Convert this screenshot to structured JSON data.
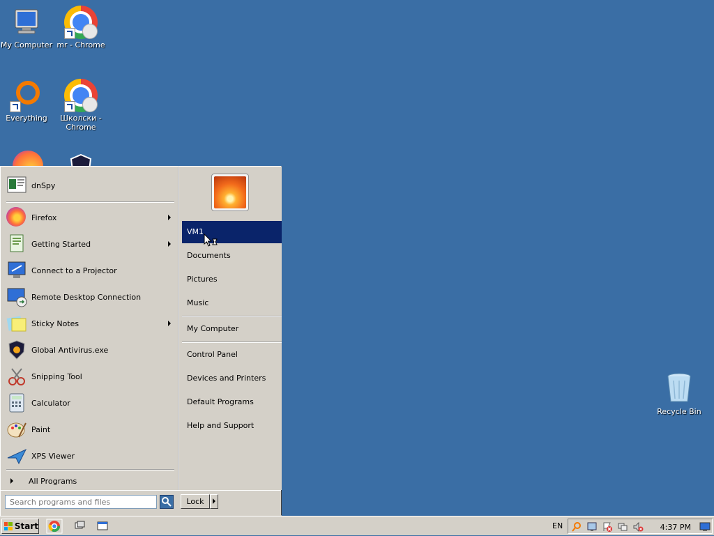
{
  "desktop": {
    "icons": [
      {
        "label": "My Computer",
        "icon": "computer-icon"
      },
      {
        "label": "mr - Chrome",
        "icon": "chrome-icon"
      },
      {
        "label": "Everything",
        "icon": "everything-icon"
      },
      {
        "label": "Школски - Chrome",
        "icon": "chrome-icon"
      }
    ],
    "recycle_bin": {
      "label": "Recycle Bin",
      "icon": "recycle-bin-icon"
    }
  },
  "start_menu": {
    "pinned": {
      "label": "dnSpy",
      "icon": "dnspy-icon"
    },
    "recent": [
      {
        "label": "Firefox",
        "icon": "firefox-icon",
        "submenu": true
      },
      {
        "label": "Getting Started",
        "icon": "getting-started-icon",
        "submenu": true
      },
      {
        "label": "Connect to a Projector",
        "icon": "projector-icon",
        "submenu": false
      },
      {
        "label": "Remote Desktop Connection",
        "icon": "remote-desktop-icon",
        "submenu": false
      },
      {
        "label": "Sticky Notes",
        "icon": "sticky-notes-icon",
        "submenu": true
      },
      {
        "label": "Global Antivirus.exe",
        "icon": "antivirus-shield-icon",
        "submenu": false
      },
      {
        "label": "Snipping Tool",
        "icon": "snipping-tool-icon",
        "submenu": false
      },
      {
        "label": "Calculator",
        "icon": "calculator-icon",
        "submenu": false
      },
      {
        "label": "Paint",
        "icon": "paint-icon",
        "submenu": false
      },
      {
        "label": "XPS Viewer",
        "icon": "xps-viewer-icon",
        "submenu": false
      }
    ],
    "all_programs": "All Programs",
    "right": {
      "user_section": [
        "VM1",
        "Documents",
        "Pictures",
        "Music"
      ],
      "computer_section": [
        "My Computer"
      ],
      "system_section": [
        "Control Panel",
        "Devices and Printers",
        "Default Programs",
        "Help and Support"
      ],
      "selected": "VM1"
    },
    "search": {
      "placeholder": "Search programs and files",
      "value": ""
    },
    "lock_label": "Lock"
  },
  "taskbar": {
    "start_label": "Start",
    "language": "EN",
    "clock": "4:37 PM"
  },
  "colors": {
    "desktop": "#3a6ea5",
    "menu_bg": "#d4d0c8",
    "selection": "#0a246a"
  }
}
